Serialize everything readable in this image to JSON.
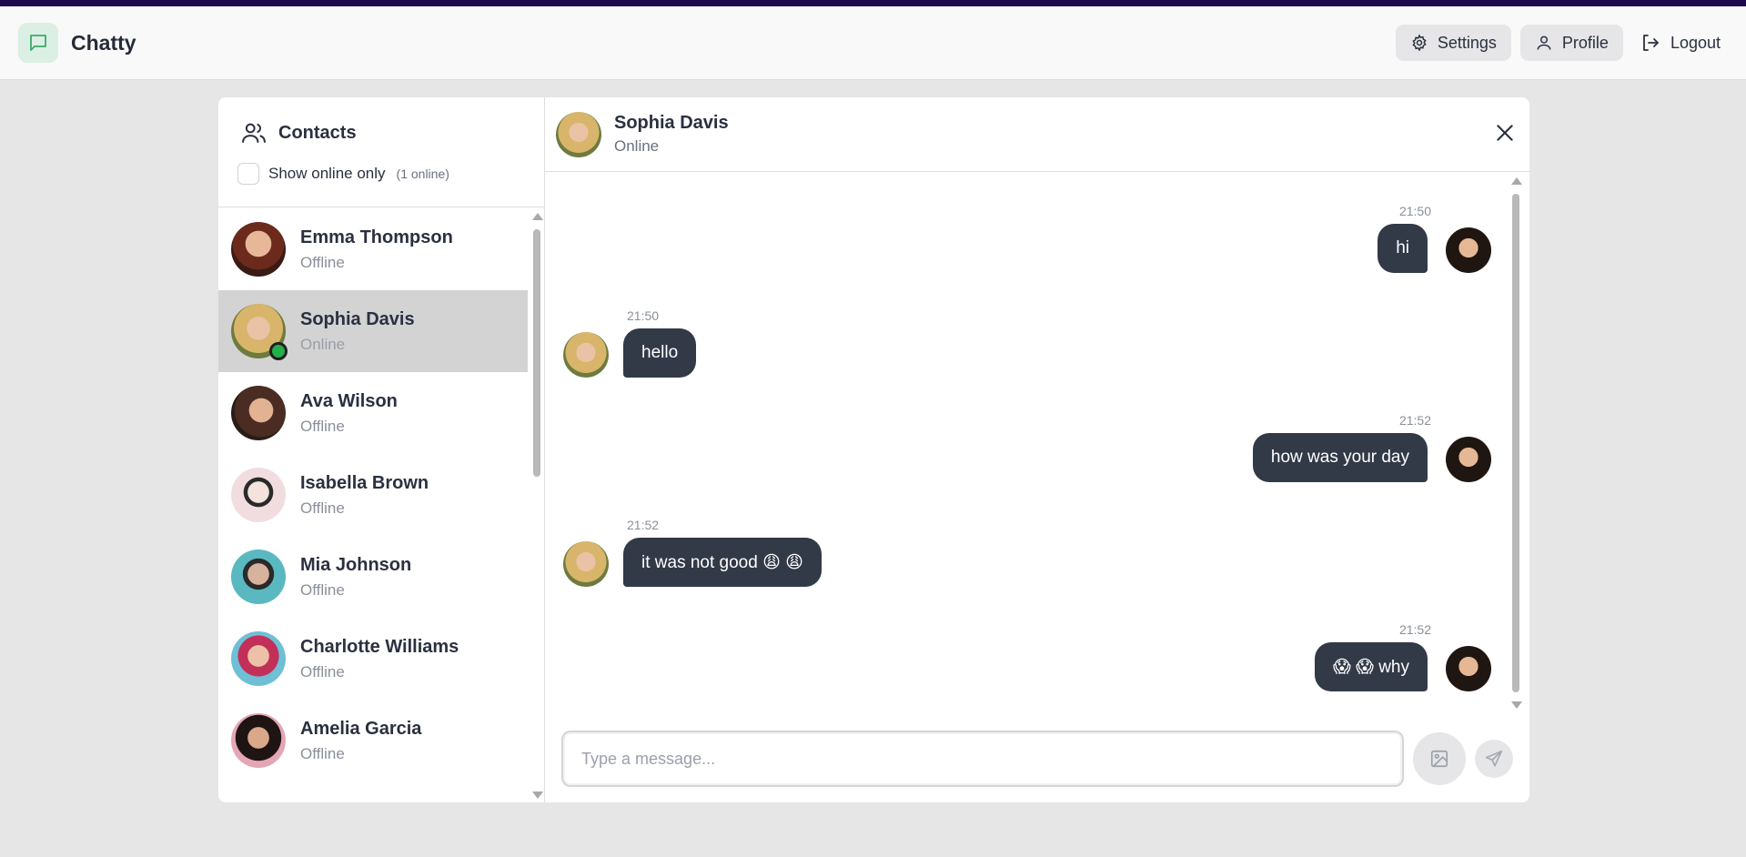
{
  "app": {
    "name": "Chatty"
  },
  "nav": {
    "settings": "Settings",
    "profile": "Profile",
    "logout": "Logout"
  },
  "sidebar": {
    "title": "Contacts",
    "filter_label": "Show online only",
    "online_count": "(1 online)",
    "contacts": [
      {
        "name": "Emma Thompson",
        "status": "Offline"
      },
      {
        "name": "Sophia Davis",
        "status": "Online"
      },
      {
        "name": "Ava Wilson",
        "status": "Offline"
      },
      {
        "name": "Isabella Brown",
        "status": "Offline"
      },
      {
        "name": "Mia Johnson",
        "status": "Offline"
      },
      {
        "name": "Charlotte Williams",
        "status": "Offline"
      },
      {
        "name": "Amelia Garcia",
        "status": "Offline"
      }
    ]
  },
  "chat": {
    "name": "Sophia Davis",
    "status": "Online",
    "messages": [
      {
        "time": "21:50",
        "text": "hi",
        "from": "me"
      },
      {
        "time": "21:50",
        "text": "hello",
        "from": "them"
      },
      {
        "time": "21:52",
        "text": "how was your day",
        "from": "me"
      },
      {
        "time": "21:52",
        "text": "it was not good 😩 😩",
        "from": "them"
      },
      {
        "time": "21:52",
        "text": "😱 😱  why",
        "from": "me"
      }
    ],
    "input_placeholder": "Type a message..."
  },
  "colors": {
    "accent": "#1d0b4d",
    "bubble": "#323947",
    "online": "#22b04b"
  }
}
